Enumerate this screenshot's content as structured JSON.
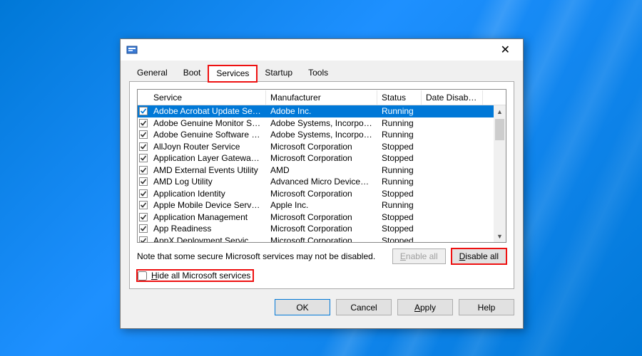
{
  "tabs": {
    "general": "General",
    "boot": "Boot",
    "services": "Services",
    "startup": "Startup",
    "tools": "Tools"
  },
  "columns": {
    "service": "Service",
    "manufacturer": "Manufacturer",
    "status": "Status",
    "date_disabled": "Date Disabled"
  },
  "rows": [
    {
      "service": "Adobe Acrobat Update Service",
      "manufacturer": "Adobe Inc.",
      "status": "Running",
      "date": ""
    },
    {
      "service": "Adobe Genuine Monitor Service",
      "manufacturer": "Adobe Systems, Incorpora...",
      "status": "Running",
      "date": ""
    },
    {
      "service": "Adobe Genuine Software Integri...",
      "manufacturer": "Adobe Systems, Incorpora...",
      "status": "Running",
      "date": ""
    },
    {
      "service": "AllJoyn Router Service",
      "manufacturer": "Microsoft Corporation",
      "status": "Stopped",
      "date": ""
    },
    {
      "service": "Application Layer Gateway Service",
      "manufacturer": "Microsoft Corporation",
      "status": "Stopped",
      "date": ""
    },
    {
      "service": "AMD External Events Utility",
      "manufacturer": "AMD",
      "status": "Running",
      "date": ""
    },
    {
      "service": "AMD Log Utility",
      "manufacturer": "Advanced Micro Devices, I...",
      "status": "Running",
      "date": ""
    },
    {
      "service": "Application Identity",
      "manufacturer": "Microsoft Corporation",
      "status": "Stopped",
      "date": ""
    },
    {
      "service": "Apple Mobile Device Service",
      "manufacturer": "Apple Inc.",
      "status": "Running",
      "date": ""
    },
    {
      "service": "Application Management",
      "manufacturer": "Microsoft Corporation",
      "status": "Stopped",
      "date": ""
    },
    {
      "service": "App Readiness",
      "manufacturer": "Microsoft Corporation",
      "status": "Stopped",
      "date": ""
    },
    {
      "service": "AppX Deployment Service (AppX...",
      "manufacturer": "Microsoft Corporation",
      "status": "Stopped",
      "date": ""
    }
  ],
  "note": "Note that some secure Microsoft services may not be disabled.",
  "buttons": {
    "enable_all": "Enable all",
    "disable_all": "Disable all",
    "ok": "OK",
    "cancel": "Cancel",
    "apply": "Apply",
    "help": "Help"
  },
  "hide_label": "Hide all Microsoft services"
}
